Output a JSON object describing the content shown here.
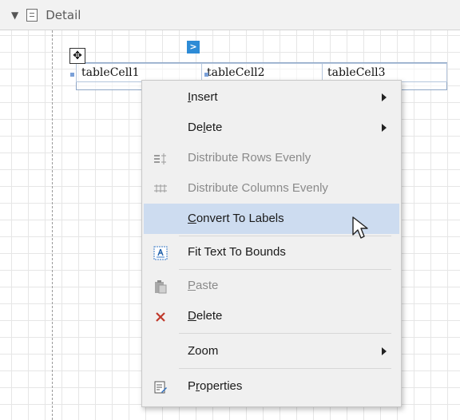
{
  "band": {
    "title": "Detail"
  },
  "table": {
    "cells": [
      "tableCell1",
      "tableCell2",
      "tableCell3"
    ]
  },
  "smart_tag": {
    "glyph": ">"
  },
  "menu": {
    "items": [
      {
        "pre": "",
        "ul": "I",
        "post": "nsert",
        "submenu": true,
        "enabled": true,
        "icon": ""
      },
      {
        "pre": "De",
        "ul": "l",
        "post": "ete",
        "submenu": true,
        "enabled": true,
        "icon": ""
      },
      {
        "pre": "Distribute Rows Evenly",
        "ul": "",
        "post": "",
        "submenu": false,
        "enabled": false,
        "icon": "distribute-rows-icon"
      },
      {
        "pre": "Distribute Columns Evenly",
        "ul": "",
        "post": "",
        "submenu": false,
        "enabled": false,
        "icon": "distribute-columns-icon"
      },
      {
        "pre": "",
        "ul": "C",
        "post": "onvert To Labels",
        "submenu": false,
        "enabled": true,
        "highlighted": true,
        "icon": ""
      },
      {
        "pre": "Fit Text To Bounds",
        "ul": "",
        "post": "",
        "submenu": false,
        "enabled": true,
        "icon": "fit-text-icon"
      },
      {
        "pre": "",
        "ul": "P",
        "post": "aste",
        "submenu": false,
        "enabled": false,
        "icon": "paste-icon"
      },
      {
        "pre": "",
        "ul": "D",
        "post": "elete",
        "submenu": false,
        "enabled": true,
        "icon": "delete-icon"
      },
      {
        "pre": "Zoom",
        "ul": "",
        "post": "",
        "submenu": true,
        "enabled": true,
        "icon": ""
      },
      {
        "pre": "P",
        "ul": "r",
        "post": "operties",
        "submenu": false,
        "enabled": true,
        "icon": "properties-icon"
      }
    ]
  },
  "colors": {
    "highlight": "#cddcf0",
    "accent": "#2d8bd6",
    "delete": "#c0392b"
  }
}
